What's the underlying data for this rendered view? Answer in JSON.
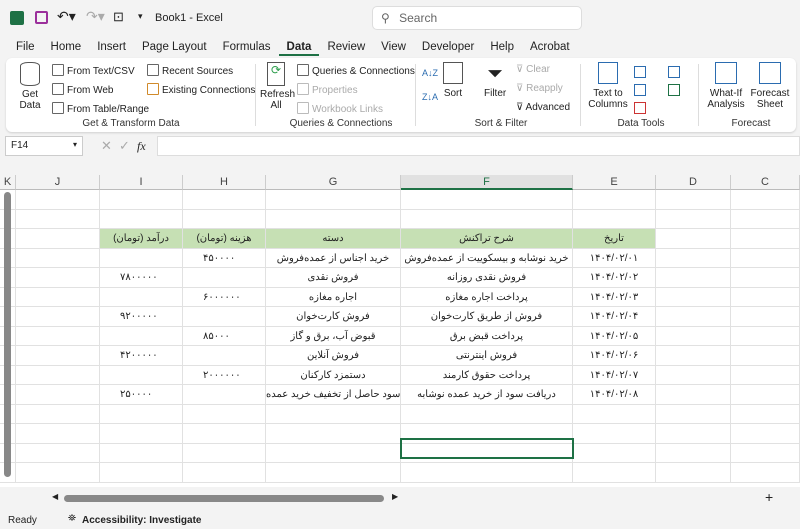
{
  "titlebar": {
    "title": "Book1  -  Excel",
    "search_placeholder": "Search"
  },
  "tabs": [
    "File",
    "Home",
    "Insert",
    "Page Layout",
    "Formulas",
    "Data",
    "Review",
    "View",
    "Developer",
    "Help",
    "Acrobat"
  ],
  "active_tab": "Data",
  "ribbon": {
    "get_data": "Get Data",
    "from_text": "From Text/CSV",
    "from_web": "From Web",
    "from_table": "From Table/Range",
    "recent": "Recent Sources",
    "existing": "Existing Connections",
    "group1": "Get & Transform Data",
    "refresh": "Refresh All",
    "queries": "Queries & Connections",
    "properties": "Properties",
    "workbook_links": "Workbook Links",
    "group2": "Queries & Connections",
    "sort": "Sort",
    "filter": "Filter",
    "clear": "Clear",
    "reapply": "Reapply",
    "advanced": "Advanced",
    "group3": "Sort & Filter",
    "text_to_columns": "Text to Columns",
    "group4": "Data Tools",
    "what_if": "What-If Analysis",
    "forecast_sheet": "Forecast Sheet",
    "group5": "Forecast"
  },
  "formula_bar": {
    "name_box": "F14",
    "fx": "fx",
    "value": ""
  },
  "columns": [
    "K",
    "J",
    "I",
    "H",
    "G",
    "F",
    "E",
    "D",
    "C"
  ],
  "selected_column": "F",
  "header": [
    "درآمد (تومان)",
    "هزینه (تومان)",
    "دسته",
    "شرح تراکنش",
    "تاریخ"
  ],
  "rows": [
    [
      "",
      "۴۵۰۰۰۰",
      "خرید اجناس از عمده‌فروش",
      "خرید نوشابه و بیسکوییت از عمده‌فروش",
      "۱۴۰۴/۰۲/۰۱"
    ],
    [
      "۷۸۰۰۰۰۰",
      "",
      "فروش نقدی",
      "فروش نقدی روزانه",
      "۱۴۰۴/۰۲/۰۲"
    ],
    [
      "",
      "۶۰۰۰۰۰۰",
      "اجاره مغازه",
      "پرداخت اجاره مغازه",
      "۱۴۰۴/۰۲/۰۳"
    ],
    [
      "۹۲۰۰۰۰۰",
      "",
      "فروش کارت‌خوان",
      "فروش از طریق کارت‌خوان",
      "۱۴۰۴/۰۲/۰۴"
    ],
    [
      "",
      "۸۵۰۰۰",
      "قبوض آب، برق و گاز",
      "پرداخت قبض برق",
      "۱۴۰۴/۰۲/۰۵"
    ],
    [
      "۴۲۰۰۰۰۰",
      "",
      "فروش آنلاین",
      "فروش اینترنتی",
      "۱۴۰۴/۰۲/۰۶"
    ],
    [
      "",
      "۲۰۰۰۰۰۰",
      "دستمزد کارکنان",
      "پرداخت حقوق کارمند",
      "۱۴۰۴/۰۲/۰۷"
    ],
    [
      "۲۵۰۰۰۰",
      "",
      "سود حاصل از تخفیف خرید عمده",
      "دریافت سود از خرید عمده نوشابه",
      "۱۴۰۴/۰۲/۰۸"
    ]
  ],
  "status": {
    "ready": "Ready",
    "accessibility": "Accessibility: Investigate"
  },
  "colors": {
    "accent": "#1e7145",
    "header_fill": "#c6e0b4"
  }
}
